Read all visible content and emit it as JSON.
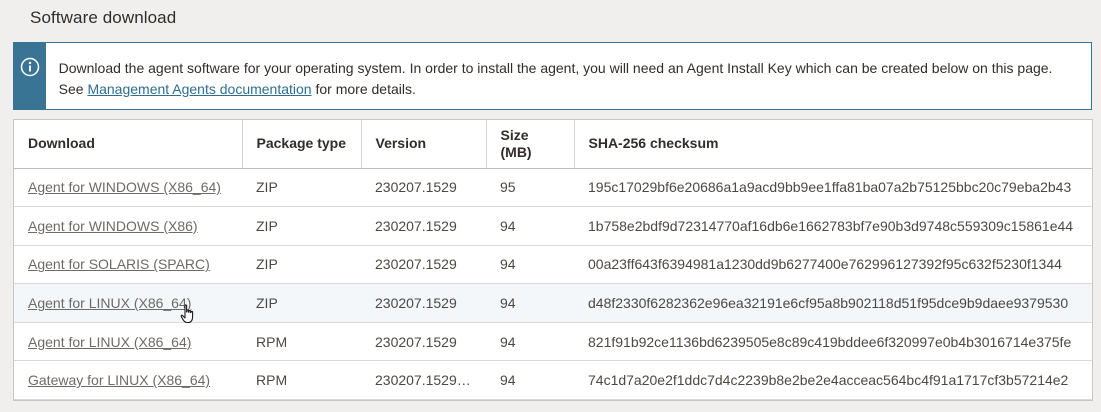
{
  "section": {
    "title": "Software download"
  },
  "info": {
    "text_before": "Download the agent software for your operating system. In order to install the agent, you will need an Agent Install Key which can be created below on this page. See ",
    "link": "Management Agents documentation",
    "text_after": " for more details."
  },
  "table": {
    "headers": {
      "download": "Download",
      "package_type": "Package type",
      "version": "Version",
      "size": "Size (MB)",
      "checksum": "SHA-256 checksum"
    },
    "rows": [
      {
        "download": "Agent for WINDOWS (X86_64)",
        "type": "ZIP",
        "version": "230207.1529",
        "size": "95",
        "checksum": "195c17029bf6e20686a1a9acd9bb9ee1ffa81ba07a2b75125bbc20c79eba2b43"
      },
      {
        "download": "Agent for WINDOWS (X86)",
        "type": "ZIP",
        "version": "230207.1529",
        "size": "94",
        "checksum": "1b758e2bdf9d72314770af16db6e1662783bf7e90b3d9748c559309c15861e44"
      },
      {
        "download": "Agent for SOLARIS (SPARC)",
        "type": "ZIP",
        "version": "230207.1529",
        "size": "94",
        "checksum": "00a23ff643f6394981a1230dd9b6277400e762996127392f95c632f5230f1344"
      },
      {
        "download": "Agent for LINUX (X86_64)",
        "type": "ZIP",
        "version": "230207.1529",
        "size": "94",
        "checksum": "d48f2330f6282362e96ea32191e6cf95a8b902118d51f95dce9b9daee9379530"
      },
      {
        "download": "Agent for LINUX (X86_64)",
        "type": "RPM",
        "version": "230207.1529",
        "size": "94",
        "checksum": "821f91b92ce1136bd6239505e8c89c419bddee6f320997e0b4b3016714e375fe"
      },
      {
        "download": "Gateway for LINUX (X86_64)",
        "type": "RPM",
        "version": "230207.1529…",
        "size": "94",
        "checksum": "74c1d7a20e2f1ddc7d4c2239b8e2be2e4acceac564bc4f91a1717cf3b57214e2"
      }
    ]
  },
  "colors": {
    "accent": "#3a7494",
    "link": "#2d6e8f",
    "background": "#f1efed"
  },
  "icons": {
    "info": "info-icon",
    "cursor": "hand-pointer-icon"
  }
}
